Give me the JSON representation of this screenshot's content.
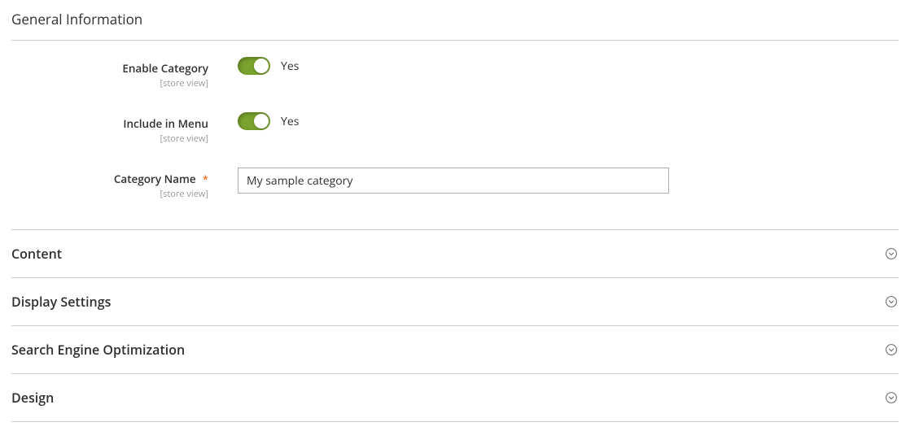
{
  "section": {
    "title": "General Information",
    "fields": {
      "enable_category": {
        "label": "Enable Category",
        "scope": "[store view]",
        "value": true,
        "value_label": "Yes"
      },
      "include_in_menu": {
        "label": "Include in Menu",
        "scope": "[store view]",
        "value": true,
        "value_label": "Yes"
      },
      "category_name": {
        "label": "Category Name",
        "scope": "[store view]",
        "required": true,
        "value": "My sample category"
      }
    }
  },
  "collapsibles": [
    {
      "title": "Content"
    },
    {
      "title": "Display Settings"
    },
    {
      "title": "Search Engine Optimization"
    },
    {
      "title": "Design"
    }
  ],
  "required_asterisk": "*"
}
